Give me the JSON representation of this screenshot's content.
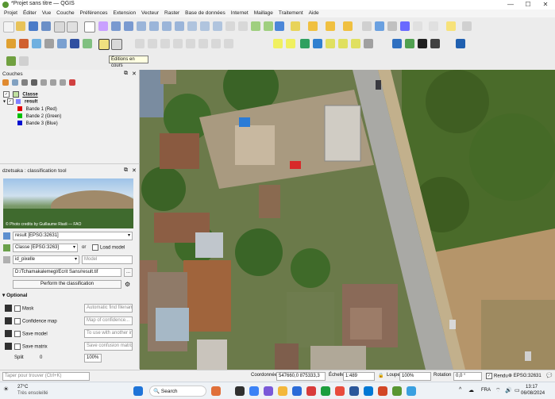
{
  "window": {
    "title": "*Projet sans titre — QGIS",
    "minimize": "—",
    "maximize": "☐",
    "close": "✕"
  },
  "menu": [
    "Projet",
    "Éditer",
    "Vue",
    "Couche",
    "Préférences",
    "Extension",
    "Vecteur",
    "Raster",
    "Base de données",
    "Internet",
    "Maillage",
    "Traitement",
    "Aide"
  ],
  "tooltip": "Éditions en cours",
  "layers_panel": {
    "title": "Couches",
    "items": [
      {
        "label": "Classe"
      },
      {
        "label": "result"
      },
      {
        "label": "Bande 1 (Red)",
        "color": "#e00000"
      },
      {
        "label": "Bande 2 (Green)",
        "color": "#00c000"
      },
      {
        "label": "Bande 3 (Blue)",
        "color": "#0010d0"
      }
    ]
  },
  "dzetsaka": {
    "title": "dzetsaka : classification tool",
    "photo_caption": "© Photo credits by Guillaume Riadi — FAO",
    "raster_select": "result [EPSG:32631]",
    "vector_select": "Classe [EPSG:3263]",
    "or_label": "or",
    "load_model_label": "Load model",
    "field_select": "id_pixelle",
    "model_placeholder": "Model",
    "output_path": "D:/Tchamakalemegl/Ecrit Sans/result.tif",
    "browse_button": "...",
    "perform_button": "Perform the classification",
    "optional_label": "Optional",
    "mask_label": "Mask",
    "mask_placeholder": "Automatic find filename_...",
    "confidence_label": "Confidence map",
    "confidence_placeholder": "Map of confidence...",
    "save_model_label": "Save model",
    "save_model_placeholder": "To use with another im...",
    "save_matrix_label": "Save matrix",
    "save_matrix_placeholder": "Save confusion matrix",
    "split_label": "Split",
    "split_value": "0",
    "split_percent": "100%"
  },
  "locator": {
    "placeholder": "Taper pour trouver (Ctrl+K)"
  },
  "status": {
    "coord_label": "Coordonnée",
    "coord_value": "547660,0  875333,3",
    "scale_label": "Échelle",
    "scale_value": "1:489",
    "magnifier_label": "Loupe",
    "magnifier_value": "100%",
    "rotation_label": "Rotation",
    "rotation_value": "0,0 °",
    "render_label": "Rendu",
    "crs_label": "EPSG:32631"
  },
  "taskbar": {
    "weather_temp": "27°C",
    "weather_desc": "Très ensoleillé",
    "search_label": "Search",
    "lang": "FRA",
    "time": "13:17",
    "date": "06/08/2024"
  }
}
